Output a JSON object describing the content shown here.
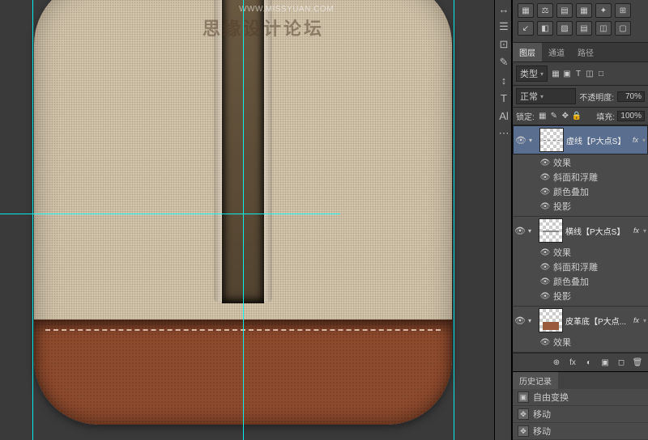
{
  "watermark_url": "WWW.MISSYUAN.COM",
  "watermark_text": "思缘设计论坛",
  "guides": {
    "v": [
      40,
      300,
      560
    ],
    "h": [
      264
    ]
  },
  "tool_icons": [
    "↔",
    "☰",
    "⊡",
    "✎",
    "↕",
    "T",
    "Al",
    "⋯"
  ],
  "option_icons": [
    "▦",
    "⚖",
    "▤",
    "▦",
    "✦",
    "⊞",
    "↙",
    "◧",
    "▨",
    "▤",
    "◫",
    "▢"
  ],
  "panels": {
    "tabs": [
      "图层",
      "通道",
      "路径"
    ],
    "active_tab": 0,
    "type_row": {
      "label": "类型",
      "icons": [
        "▦",
        "▣",
        "T",
        "◫",
        "□"
      ]
    },
    "blend": {
      "mode": "正常",
      "opacity_label": "不透明度:",
      "opacity": "70%"
    },
    "lock": {
      "label": "锁定:",
      "icons": [
        "▦",
        "✎",
        "✥",
        "🔒"
      ],
      "fill_label": "填充:",
      "fill": "100%"
    }
  },
  "layers": [
    {
      "name": "虚线【P大点S】",
      "selected": true,
      "fx": true,
      "effects": [
        "效果",
        "斜面和浮雕",
        "颜色叠加",
        "投影"
      ],
      "thumb": "dashes"
    },
    {
      "name": "横线【P大点S】",
      "selected": false,
      "fx": true,
      "effects": [
        "效果",
        "斜面和浮雕",
        "颜色叠加",
        "投影"
      ],
      "thumb": "line"
    },
    {
      "name": "皮革底【P大点...",
      "selected": false,
      "fx": true,
      "effects": [
        "效果"
      ],
      "thumb": "leather"
    }
  ],
  "footer_icons": [
    "⊕",
    "fx",
    "◐",
    "▣",
    "◻",
    "🗑"
  ],
  "history": {
    "title": "历史记录",
    "items": [
      {
        "icon": "▣",
        "label": "自由变换"
      },
      {
        "icon": "✥",
        "label": "移动"
      },
      {
        "icon": "✥",
        "label": "移动"
      }
    ]
  }
}
